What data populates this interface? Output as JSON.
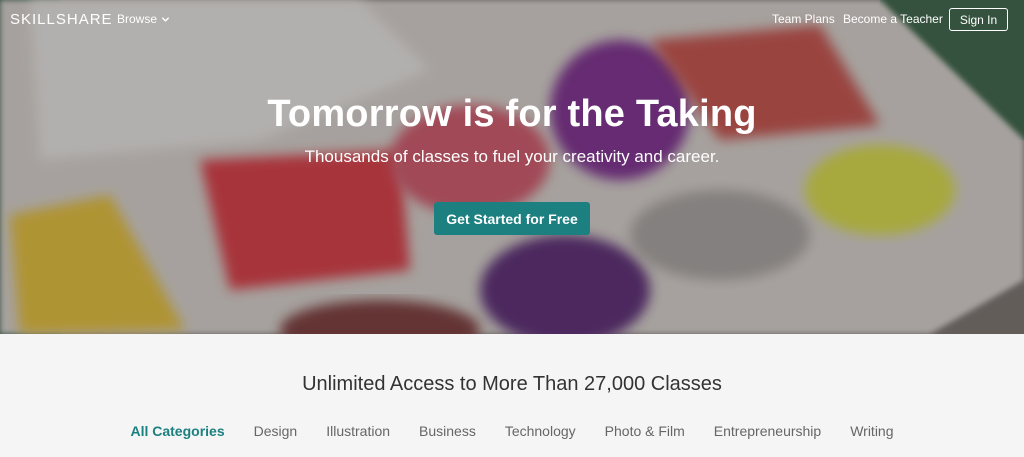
{
  "nav": {
    "logo": "SKILLSHARE",
    "browse": "Browse",
    "team_plans": "Team Plans",
    "become_teacher": "Become a Teacher",
    "sign_in": "Sign In"
  },
  "hero": {
    "title": "Tomorrow is for the Taking",
    "subtitle": "Thousands of classes to fuel your creativity and career.",
    "cta": "Get Started for Free"
  },
  "section": {
    "title": "Unlimited Access to More Than 27,000 Classes"
  },
  "categories": [
    {
      "label": "All Categories",
      "active": true
    },
    {
      "label": "Design"
    },
    {
      "label": "Illustration"
    },
    {
      "label": "Business"
    },
    {
      "label": "Technology"
    },
    {
      "label": "Photo & Film"
    },
    {
      "label": "Entrepreneurship"
    },
    {
      "label": "Writing"
    }
  ],
  "colors": {
    "accent": "#1c7f80"
  }
}
